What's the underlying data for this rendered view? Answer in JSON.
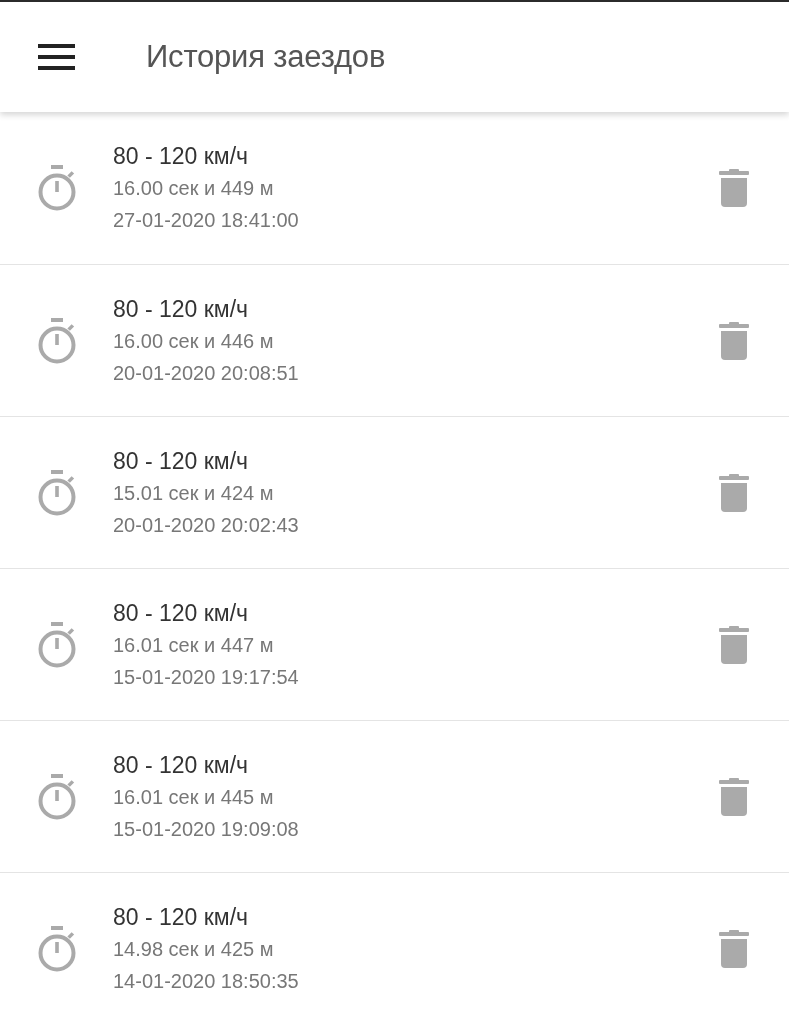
{
  "app_bar": {
    "title": "История заездов"
  },
  "runs": [
    {
      "title": "80 - 120 км/ч",
      "result": "16.00 сек и 449 м",
      "date": "27-01-2020 18:41:00"
    },
    {
      "title": "80 - 120 км/ч",
      "result": "16.00 сек и 446 м",
      "date": "20-01-2020 20:08:51"
    },
    {
      "title": "80 - 120 км/ч",
      "result": "15.01 сек и 424 м",
      "date": "20-01-2020 20:02:43"
    },
    {
      "title": "80 - 120 км/ч",
      "result": "16.01 сек и 447 м",
      "date": "15-01-2020 19:17:54"
    },
    {
      "title": "80 - 120 км/ч",
      "result": "16.01 сек и 445 м",
      "date": "15-01-2020 19:09:08"
    },
    {
      "title": "80 - 120 км/ч",
      "result": "14.98 сек и 425 м",
      "date": "14-01-2020 18:50:35"
    }
  ]
}
